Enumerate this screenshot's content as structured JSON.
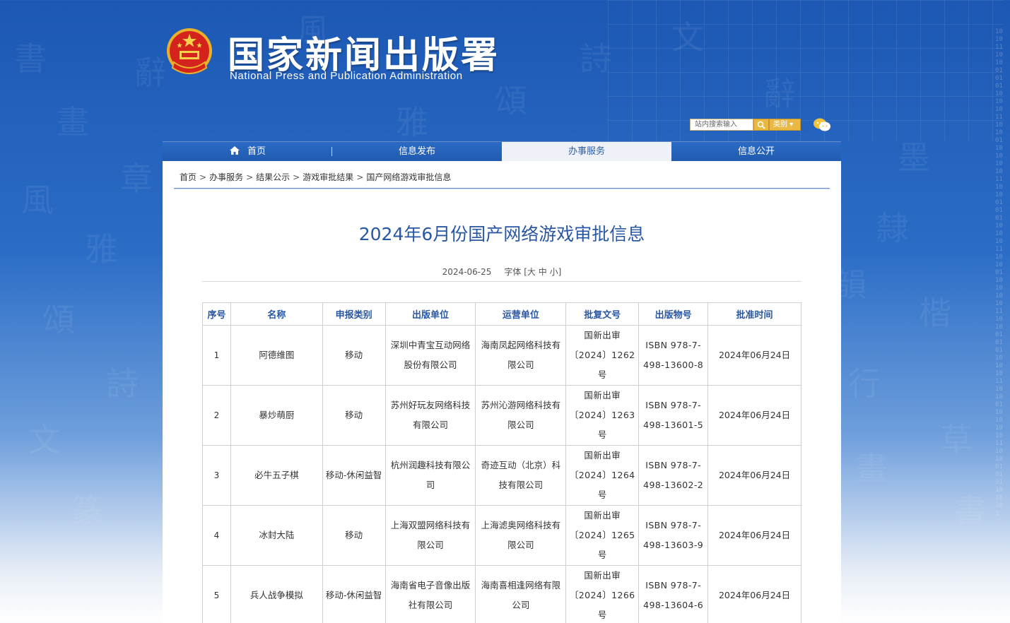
{
  "header": {
    "title_cn": "国家新闻出版署",
    "title_en": "National  Press and Publication Administration"
  },
  "search": {
    "placeholder": "站内搜索输入",
    "category_label": "类别 ▾"
  },
  "nav": {
    "items": [
      {
        "label": "首页"
      },
      {
        "label": "信息发布"
      },
      {
        "label": "办事服务"
      },
      {
        "label": "信息公开"
      }
    ]
  },
  "breadcrumb": {
    "items": [
      "首页",
      "办事服务",
      "结果公示",
      "游戏审批结果",
      "国产网络游戏审批信息"
    ],
    "sep": ">"
  },
  "article": {
    "title": "2024年6月份国产网络游戏审批信息",
    "date": "2024-06-25",
    "font_label": "字体 [",
    "font_large": "大",
    "font_mid": "中",
    "font_small": "小",
    "font_close": "]"
  },
  "table": {
    "headers": [
      "序号",
      "名称",
      "申报类别",
      "出版单位",
      "运营单位",
      "批复文号",
      "出版物号",
      "批准时间"
    ],
    "rows": [
      {
        "no": "1",
        "name": "阿德维图",
        "type": "移动",
        "publisher": "深圳中青宝互动网络股份有限公司",
        "operator": "海南凤起网络科技有限公司",
        "approval": "国新出审〔2024〕1262号",
        "isbn": "ISBN 978-7-498-13600-8",
        "date": "2024年06月24日"
      },
      {
        "no": "2",
        "name": "暴炒萌厨",
        "type": "移动",
        "publisher": "苏州好玩友网络科技有限公司",
        "operator": "苏州沁游网络科技有限公司",
        "approval": "国新出审〔2024〕1263号",
        "isbn": "ISBN 978-7-498-13601-5",
        "date": "2024年06月24日"
      },
      {
        "no": "3",
        "name": "必牛五子棋",
        "type": "移动-休闲益智",
        "publisher": "杭州润趣科技有限公司",
        "operator": "奇迹互动（北京）科技有限公司",
        "approval": "国新出审〔2024〕1264号",
        "isbn": "ISBN 978-7-498-13602-2",
        "date": "2024年06月24日"
      },
      {
        "no": "4",
        "name": "冰封大陆",
        "type": "移动",
        "publisher": "上海双盟网络科技有限公司",
        "operator": "上海滤奥网络科技有限公司",
        "approval": "国新出审〔2024〕1265号",
        "isbn": "ISBN 978-7-498-13603-9",
        "date": "2024年06月24日"
      },
      {
        "no": "5",
        "name": "兵人战争模拟",
        "type": "移动-休闲益智",
        "publisher": "海南省电子音像出版社有限公司",
        "operator": "海南喜相逢网络有限公司",
        "approval": "国新出审〔2024〕1266号",
        "isbn": "ISBN 978-7-498-13604-6",
        "date": "2024年06月24日"
      }
    ]
  },
  "colors": {
    "brand_blue": "#2957a3",
    "nav_blue": "#215bb0",
    "accent_gold": "#e9b845"
  }
}
